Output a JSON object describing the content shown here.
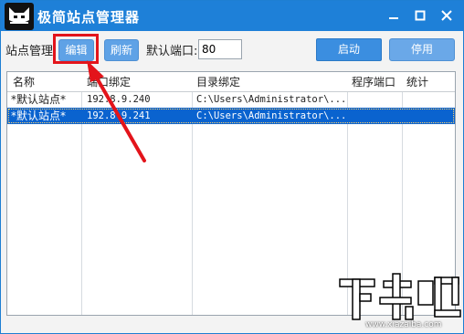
{
  "window": {
    "title": "极简站点管理器",
    "icons": {
      "app": "cat-logo-icon",
      "minimize": "minimize-icon",
      "maximize": "maximize-icon",
      "close": "close-icon"
    }
  },
  "toolbar": {
    "site_label": "站点管理:",
    "edit_label": "编辑",
    "refresh_label": "刷新",
    "port_label": "默认端口:",
    "port_value": "80",
    "start_label": "启动",
    "stop_label": "停用"
  },
  "grid": {
    "columns": [
      "名称",
      "端口绑定",
      "目录绑定",
      "程序端口",
      "统计"
    ],
    "rows": [
      {
        "name": "*默认站点*",
        "binding": "192.8.9.240",
        "dir": "C:\\Users\\Administrator\\...",
        "port": "",
        "stats": ""
      },
      {
        "name": "*默认站点*",
        "binding": "192.8.9.241",
        "dir": "C:\\Users\\Administrator\\...",
        "port": "",
        "stats": ""
      }
    ],
    "selected_row": 1
  },
  "annotation": {
    "arrow_color": "#e3141b",
    "highlight_color": "#e3141b"
  },
  "watermark": {
    "text": "下载吧",
    "url": "www.xiazaiba.com"
  },
  "colors": {
    "titlebar": "#1e80d8",
    "selection": "#0a63cf",
    "button": "#3b8ee0"
  }
}
